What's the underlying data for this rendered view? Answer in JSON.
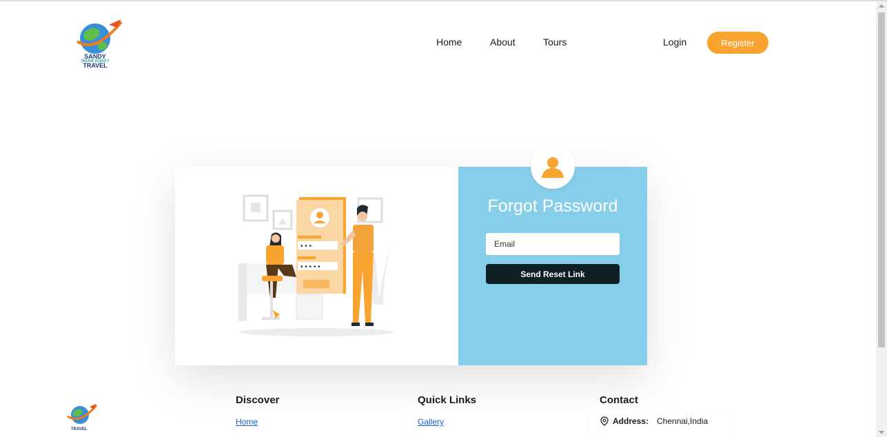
{
  "brand": {
    "logo_text_line1": "SANDY",
    "logo_text_line2": "ONLINE AGENCY",
    "logo_text_line3": "TRAVEL"
  },
  "nav": {
    "items": [
      {
        "label": "Home"
      },
      {
        "label": "About"
      },
      {
        "label": "Tours"
      }
    ],
    "login_label": "Login",
    "register_label": "Register"
  },
  "form": {
    "title": "Forgot Password",
    "email_placeholder": "Email",
    "email_value": "",
    "submit_label": "Send Reset Link"
  },
  "footer": {
    "discover": {
      "heading": "Discover",
      "links": [
        {
          "label": "Home"
        }
      ]
    },
    "quick_links": {
      "heading": "Quick Links",
      "links": [
        {
          "label": "Gallery"
        }
      ]
    },
    "contact": {
      "heading": "Contact",
      "address_label": "Address:",
      "address_value": "Chennai,India"
    }
  },
  "colors": {
    "accent": "#f9a330",
    "panel": "#87ceeb",
    "button_dark": "#0f2024"
  }
}
